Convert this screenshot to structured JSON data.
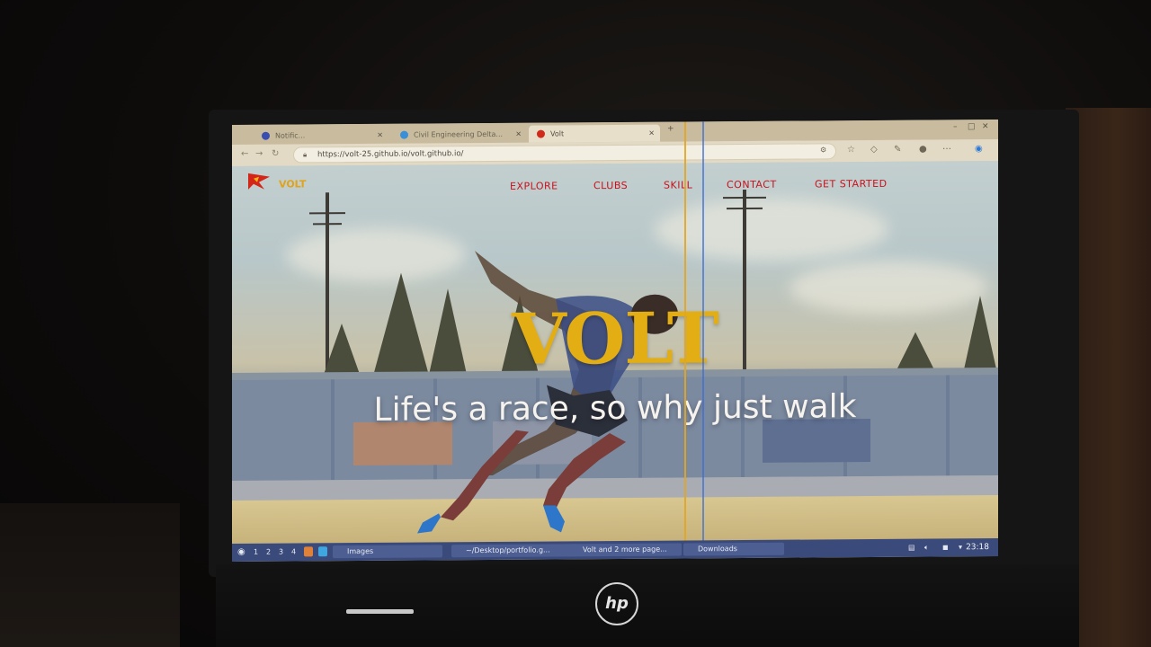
{
  "browser": {
    "tabs": [
      {
        "label": "Notific...",
        "active": false
      },
      {
        "label": "Civil Engineering Delta...",
        "active": false
      },
      {
        "label": "Volt",
        "active": true
      }
    ],
    "url": "https://volt-25.github.io/volt.github.io/"
  },
  "site": {
    "logo_text": "VOLT",
    "nav": [
      "EXPLORE",
      "CLUBS",
      "SKILL",
      "CONTACT",
      "GET STARTED"
    ],
    "hero_title": "VOLT",
    "hero_subtitle": "Life's a race, so why just walk",
    "colors": {
      "accent": "#e2ae14",
      "nav": "#c8111c"
    }
  },
  "taskbar": {
    "workspaces": [
      "1",
      "2",
      "3",
      "4"
    ],
    "items": [
      "Images",
      "~/Desktop/portfolio.g...",
      "Volt and 2 more page...",
      "Downloads"
    ],
    "clock": "23:18"
  },
  "device": {
    "brand": "hp"
  }
}
